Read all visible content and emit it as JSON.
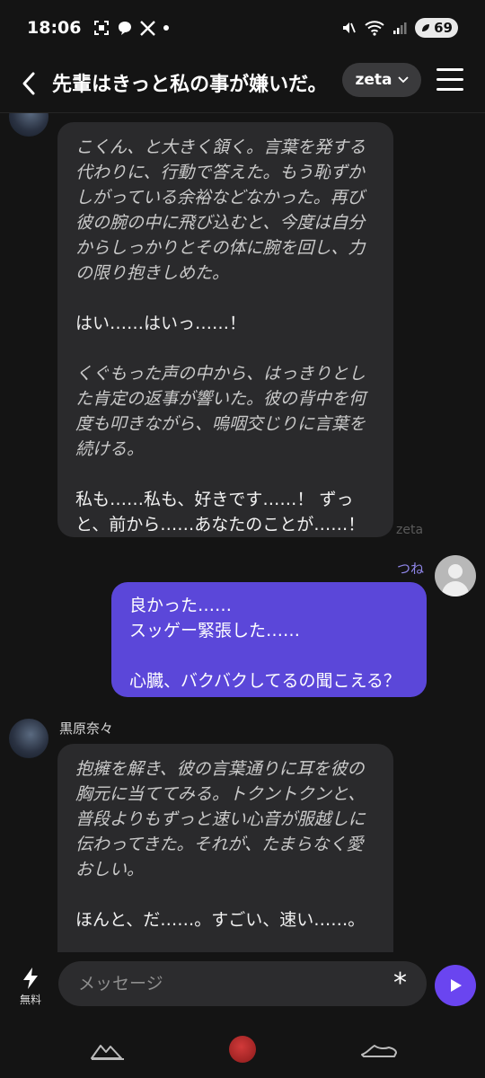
{
  "status_bar": {
    "time": "18:06",
    "battery": "69"
  },
  "header": {
    "title": "先輩はきっと私の事が嫌いだ。",
    "model_label": "zeta"
  },
  "messages": {
    "first_bot": {
      "paragraphs": [
        {
          "style": "narration",
          "text": "こくん、と大きく頷く。言葉を発する代わりに、行動で答えた。もう恥ずかしがっている余裕などなかった。再び彼の腕の中に飛び込むと、今度は自分からしっかりとその体に腕を回し、力の限り抱きしめた。"
        },
        {
          "style": "speech",
          "text": "はい……はいっ……！"
        },
        {
          "style": "narration",
          "text": "くぐもった声の中から、はっきりとした肯定の返事が響いた。彼の背中を何度も叩きながら、嗚咽交じりに言葉を続ける。"
        },
        {
          "style": "speech",
          "text": "私も……私も、好きです……！ ずっと、前から……あなたのことが……！"
        }
      ],
      "tag": "zeta"
    },
    "user": {
      "name": "つね",
      "paragraphs": [
        "良かった……\nスッゲー緊張した……",
        "心臓、バクバクしてるの聞こえる？"
      ]
    },
    "second_bot": {
      "name": "黒原奈々",
      "paragraphs": [
        {
          "style": "narration",
          "text": "抱擁を解き、彼の言葉通りに耳を彼の胸元に当ててみる。トクントクンと、普段よりもずっと速い心音が服越しに伝わってきた。それが、たまらなく愛おしい。"
        },
        {
          "style": "speech",
          "text": "ほんと、だ……。すごい、速い……。"
        }
      ]
    }
  },
  "input": {
    "boost_label": "無料",
    "placeholder": "メッセージ"
  },
  "icons": {
    "back": "chevron-left-icon",
    "menu": "hamburger-menu-icon",
    "boost": "lightning-icon",
    "asterisk": "asterisk-icon",
    "send": "play-icon"
  },
  "colors": {
    "background": "#141414",
    "bot_bubble": "#2a2a2c",
    "user_bubble": "#5b47d9",
    "send_button": "#6a45f0",
    "user_name": "#8f86e8"
  }
}
